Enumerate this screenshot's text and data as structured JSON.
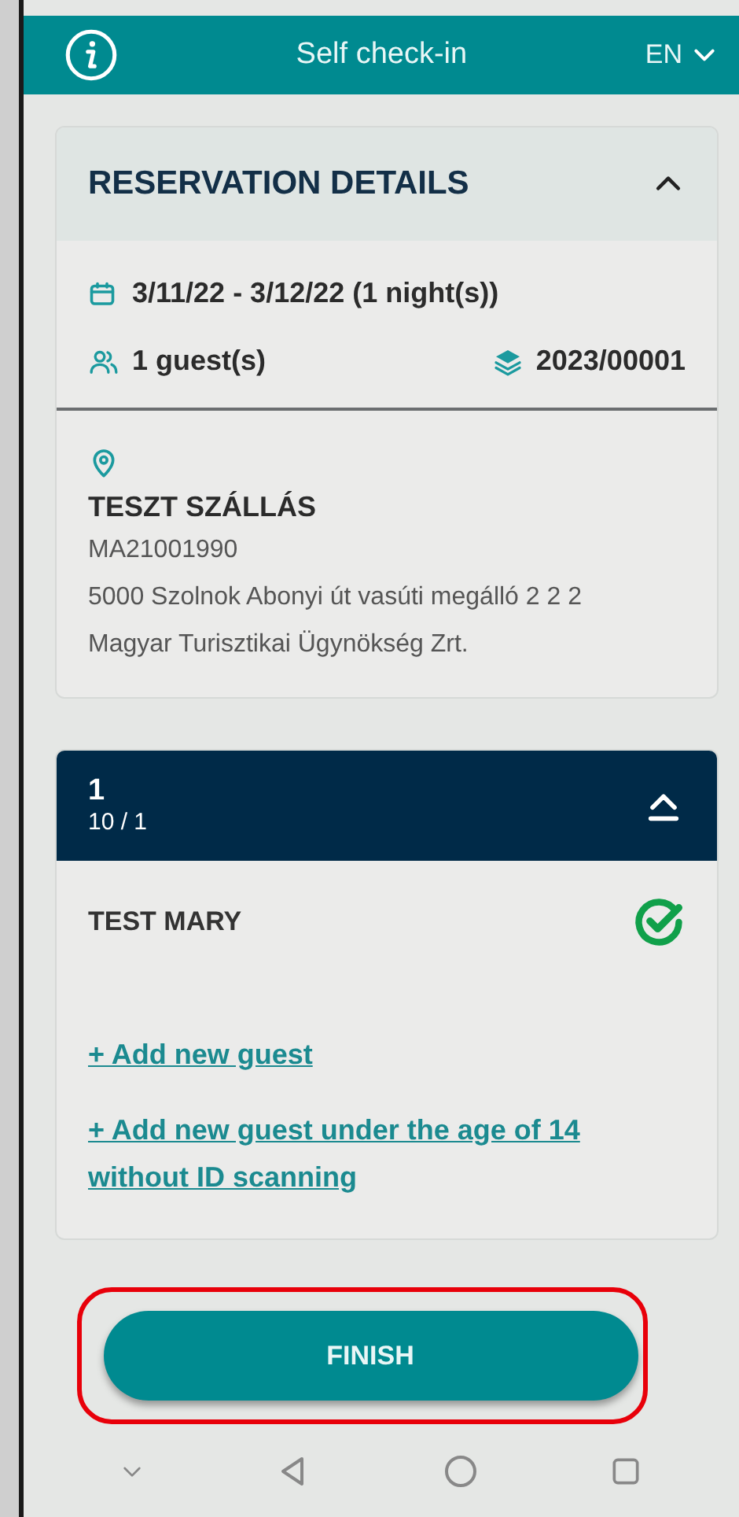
{
  "header": {
    "title": "Self check-in",
    "language": "EN"
  },
  "reservation": {
    "title": "RESERVATION DETAILS",
    "expanded": true,
    "dates": "3/11/22 - 3/12/22 (1 night(s))",
    "guests": "1 guest(s)",
    "number": "2023/00001",
    "property": {
      "name": "TESZT SZÁLLÁS",
      "code": "MA21001990",
      "address": "5000 Szolnok Abonyi út vasúti megálló 2 2 2",
      "operator": "Magyar Turisztikai Ügynökség Zrt."
    }
  },
  "room": {
    "title": "1",
    "subtitle": "10 / 1",
    "expanded": true,
    "guests": [
      {
        "name": "TEST MARY",
        "checked": true
      }
    ],
    "links": [
      "+ Add new guest",
      "+ Add new guest under the age of 14 without ID scanning"
    ]
  },
  "finish_button": "FINISH"
}
